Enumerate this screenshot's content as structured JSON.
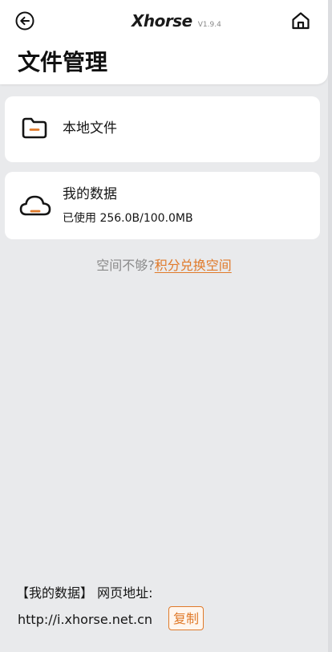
{
  "header": {
    "brand_name": "Xhorse",
    "version": "V1.9.4",
    "title": "文件管理",
    "back_icon": "back-arrow-circle-icon",
    "home_icon": "home-icon"
  },
  "cards": {
    "local": {
      "label": "本地文件",
      "icon": "folder-icon"
    },
    "data": {
      "label": "我的数据",
      "usage": "已使用 256.0B/100.0MB",
      "icon": "cloud-icon"
    }
  },
  "space_prompt": {
    "question": "空间不够?",
    "link": "积分兑换空间"
  },
  "footer": {
    "label": "【我的数据】 网页地址:",
    "url": "http://i.xhorse.net.cn",
    "copy_label": "复制"
  },
  "colors": {
    "accent": "#e07a2a",
    "background": "#e9eaec",
    "card": "#ffffff"
  }
}
